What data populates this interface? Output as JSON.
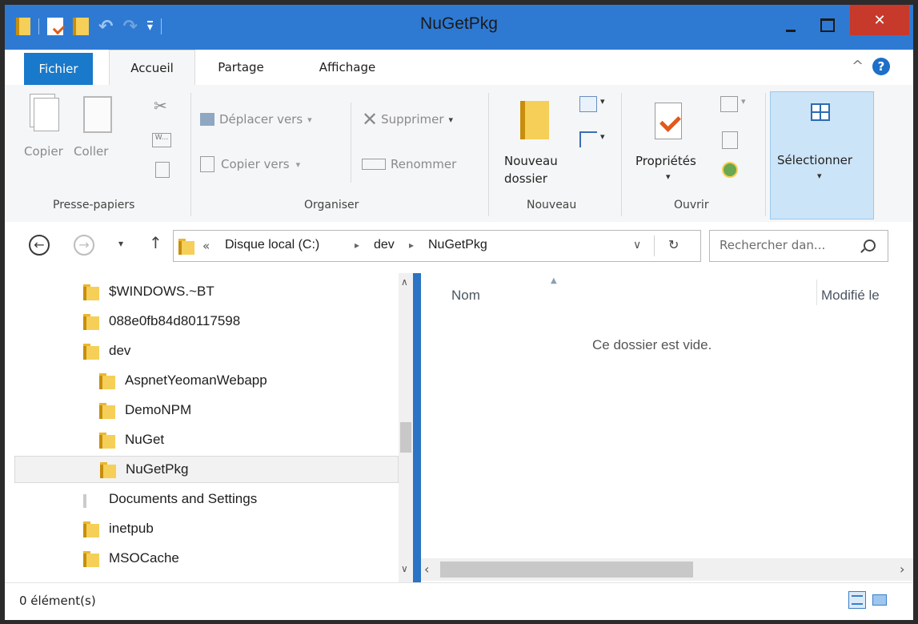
{
  "window": {
    "title": "NuGetPkg",
    "minimize": "—",
    "maximize": "☐",
    "close": "✕"
  },
  "quick_access": {
    "customize_arrow": "▾"
  },
  "tabs": [
    {
      "label": "Fichier"
    },
    {
      "label": "Accueil"
    },
    {
      "label": "Partage"
    },
    {
      "label": "Affichage"
    }
  ],
  "ribbon": {
    "collapse_glyph": "^",
    "help_glyph": "?",
    "clipboard": {
      "label": "Presse-papiers",
      "copy": "Copier",
      "paste": "Coller"
    },
    "organize": {
      "label": "Organiser",
      "move_to": "Déplacer vers",
      "copy_to": "Copier vers",
      "delete": "Supprimer",
      "rename": "Renommer"
    },
    "new": {
      "label": "Nouveau",
      "new_folder_line1": "Nouveau",
      "new_folder_line2": "dossier"
    },
    "open": {
      "label": "Ouvrir",
      "properties": "Propriétés"
    },
    "select": {
      "label": "Sélectionner"
    }
  },
  "address": {
    "overflow": "«",
    "crumbs": [
      "Disque local (C:)",
      "dev",
      "NuGetPkg"
    ],
    "separator": "▸",
    "dropdown": "∨",
    "refresh": "↻"
  },
  "search": {
    "placeholder": "Rechercher dan..."
  },
  "tree": [
    {
      "label": "$WINDOWS.~BT",
      "indent": 0
    },
    {
      "label": "088e0fb84d80117598",
      "indent": 0
    },
    {
      "label": "dev",
      "indent": 0
    },
    {
      "label": "AspnetYeomanWebapp",
      "indent": 1
    },
    {
      "label": "DemoNPM",
      "indent": 1
    },
    {
      "label": "NuGet",
      "indent": 1
    },
    {
      "label": "NuGetPkg",
      "indent": 1,
      "selected": true
    },
    {
      "label": "Documents and Settings",
      "indent": 0,
      "shortcut": true
    },
    {
      "label": "inetpub",
      "indent": 0
    },
    {
      "label": "MSOCache",
      "indent": 0
    }
  ],
  "columns": {
    "name": "Nom",
    "modified": "Modifié le"
  },
  "empty_message": "Ce dossier est vide.",
  "status": {
    "count": "0 élément(s)"
  },
  "colors": {
    "titlebar": "#2e7ad3",
    "file_tab": "#1979ca",
    "close": "#c7392a",
    "ribbon_bg": "#f5f6f7"
  }
}
